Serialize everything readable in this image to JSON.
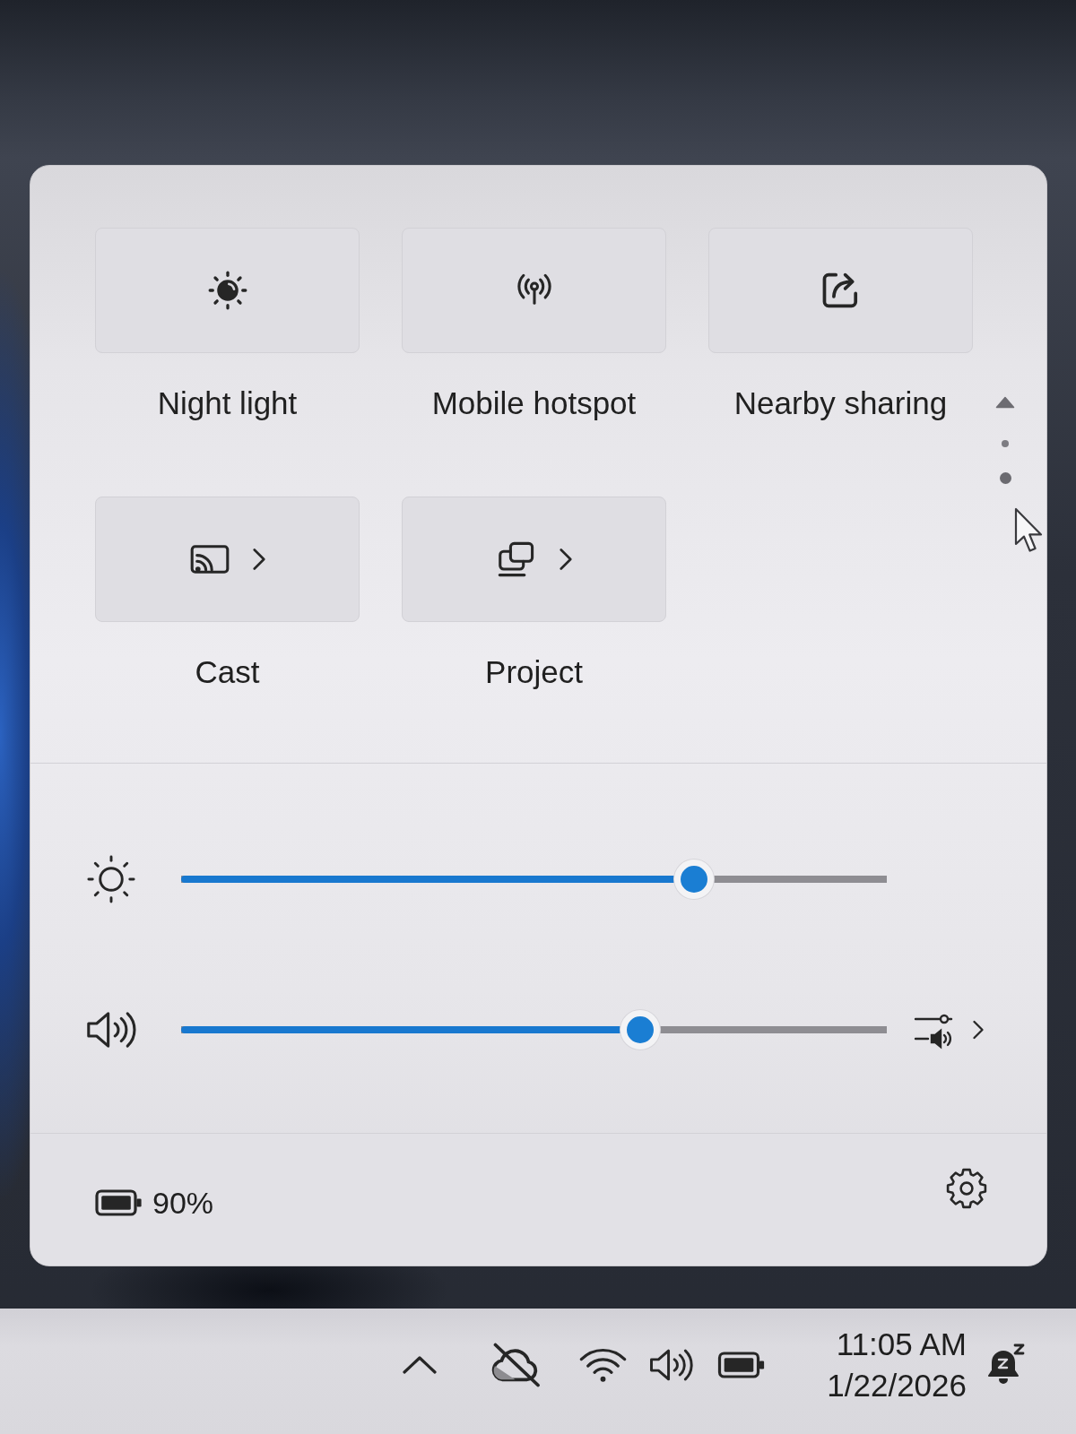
{
  "quick_settings": {
    "tiles": [
      {
        "label": "Night light",
        "kind": "toggle",
        "on": false
      },
      {
        "label": "Mobile hotspot",
        "kind": "toggle",
        "on": false
      },
      {
        "label": "Nearby sharing",
        "kind": "toggle",
        "on": false
      },
      {
        "label": "Cast",
        "kind": "menu"
      },
      {
        "label": "Project",
        "kind": "menu"
      }
    ],
    "pages": [
      {
        "selected": false
      },
      {
        "selected": true
      }
    ],
    "sliders": [
      {
        "kind": "brightness",
        "level": 0.74
      },
      {
        "kind": "volume",
        "level": 0.66
      }
    ],
    "battery": {
      "reading": "90%"
    }
  },
  "taskbar": {
    "clock": {
      "time": "11:05 AM",
      "date": "1/22/2026"
    }
  }
}
